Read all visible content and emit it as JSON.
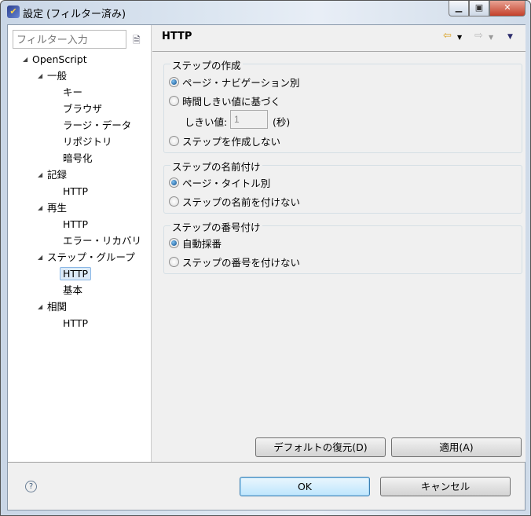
{
  "window": {
    "title": "設定 (フィルター済み)"
  },
  "filter": {
    "placeholder": "フィルター入力"
  },
  "tree": [
    {
      "label": "OpenScript",
      "level": 0,
      "arrow": true
    },
    {
      "label": "一般",
      "level": 1,
      "arrow": true
    },
    {
      "label": "キー",
      "level": 2
    },
    {
      "label": "ブラウザ",
      "level": 2
    },
    {
      "label": "ラージ・データ",
      "level": 2
    },
    {
      "label": "リポジトリ",
      "level": 2
    },
    {
      "label": "暗号化",
      "level": 2
    },
    {
      "label": "記録",
      "level": 1,
      "arrow": true
    },
    {
      "label": "HTTP",
      "level": 2
    },
    {
      "label": "再生",
      "level": 1,
      "arrow": true
    },
    {
      "label": "HTTP",
      "level": 2
    },
    {
      "label": "エラー・リカバリ",
      "level": 2
    },
    {
      "label": "ステップ・グループ",
      "level": 1,
      "arrow": true
    },
    {
      "label": "HTTP",
      "level": 2,
      "selected": true
    },
    {
      "label": "基本",
      "level": 2
    },
    {
      "label": "相関",
      "level": 1,
      "arrow": true
    },
    {
      "label": "HTTP",
      "level": 2
    }
  ],
  "page": {
    "title": "HTTP"
  },
  "groups": {
    "creation": {
      "label": "ステップの作成",
      "opt1": "ページ・ナビゲーション別",
      "opt2": "時間しきい値に基づく",
      "threshold_label": "しきい値:",
      "threshold_value": "1",
      "unit": "(秒)",
      "opt3": "ステップを作成しない"
    },
    "naming": {
      "label": "ステップの名前付け",
      "opt1": "ページ・タイトル別",
      "opt2": "ステップの名前を付けない"
    },
    "numbering": {
      "label": "ステップの番号付け",
      "opt1": "自動採番",
      "opt2": "ステップの番号を付けない"
    }
  },
  "buttons": {
    "restore": "デフォルトの復元(D)",
    "apply": "適用(A)",
    "ok": "OK",
    "cancel": "キャンセル"
  }
}
